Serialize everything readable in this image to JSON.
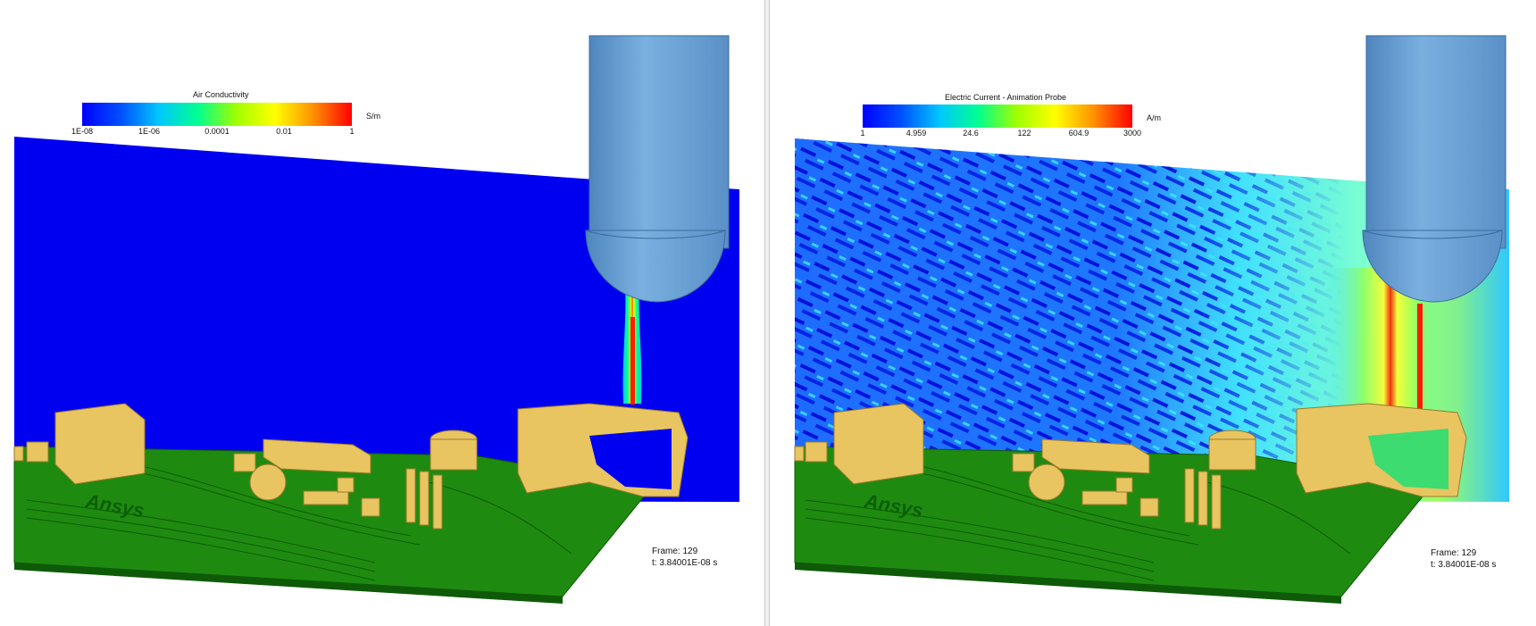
{
  "left_view": {
    "legend": {
      "title": "Air Conductivity",
      "unit": "S/m",
      "ticks": [
        "1E-08",
        "1E-06",
        "0.0001",
        "0.01",
        "1"
      ],
      "gradient": [
        "#0000ff",
        "#0050ff",
        "#00c8ff",
        "#00ff90",
        "#a0ff00",
        "#ffff00",
        "#ff9000",
        "#ff0000"
      ]
    },
    "frame_label": "Frame: 129",
    "time_label": "t: 3.84001E-08 s"
  },
  "right_view": {
    "legend": {
      "title": "Electric Current - Animation Probe",
      "unit": "A/m",
      "ticks": [
        "1",
        "4.959",
        "24.6",
        "122",
        "604.9",
        "3000"
      ],
      "gradient": [
        "#0000ff",
        "#0050ff",
        "#00c8ff",
        "#00ff90",
        "#a0ff00",
        "#ffff00",
        "#ff9000",
        "#ff0000"
      ]
    },
    "frame_label": "Frame: 129",
    "time_label": "t: 3.84001E-08 s"
  },
  "board_label": "Ansys",
  "colors": {
    "field_blue": "#0000f0",
    "board_green": "#1f8a10",
    "component_gold": "#e8c560",
    "probe_blue": "#6ea6d8",
    "arc_red": "#ff1a00"
  }
}
